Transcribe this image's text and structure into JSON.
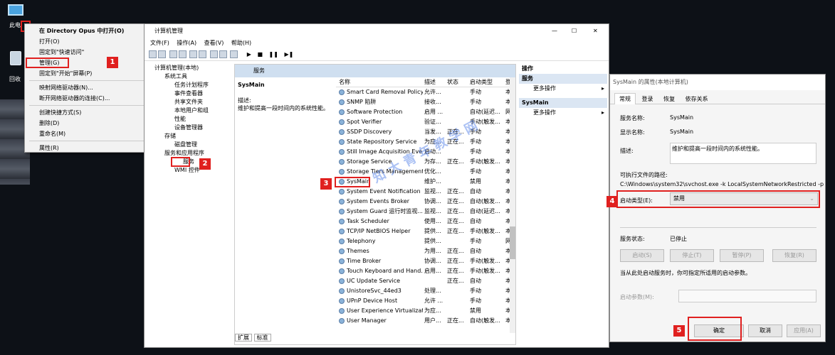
{
  "desktop": {
    "this_pc_label": "此电",
    "recycle_label": "回收"
  },
  "context_menu": {
    "items": [
      "在 Directory Opus 中打开(O)",
      "打开(O)",
      "固定到\"快速访问\"",
      "管理(G)",
      "固定到\"开始\"屏幕(P)",
      "映射网络驱动器(N)...",
      "断开网络驱动器的连接(C)...",
      "创建快捷方式(S)",
      "删除(D)",
      "重命名(M)",
      "属性(R)"
    ]
  },
  "badges": [
    "1",
    "2",
    "3",
    "4",
    "5"
  ],
  "mmc": {
    "title": "计算机管理",
    "menu": [
      "文件(F)",
      "操作(A)",
      "查看(V)",
      "帮助(H)"
    ],
    "window_controls": [
      "—",
      "☐",
      "✕"
    ],
    "tree": [
      "计算机管理(本地)",
      "系统工具",
      "任务计划程序",
      "事件查看器",
      "共享文件夹",
      "本地用户和组",
      "性能",
      "设备管理器",
      "存储",
      "磁盘管理",
      "服务和应用程序",
      "服务",
      "WMI 控件"
    ],
    "pane_header": "服务",
    "selected_service": "SysMain",
    "desc_label": "描述:",
    "desc_text": "维护和提高一段时间内的系统性能。",
    "columns": [
      "名称",
      "描述",
      "状态",
      "启动类型",
      "登"
    ],
    "rows": [
      [
        "Smart Card Removal Policy",
        "允许...",
        "",
        "手动",
        "本"
      ],
      [
        "SNMP 陷阱",
        "接收...",
        "",
        "手动",
        "本"
      ],
      [
        "Software Protection",
        "启用 ...",
        "",
        "自动(延迟...",
        "网"
      ],
      [
        "Spot Verifier",
        "验证...",
        "",
        "手动(触发...",
        "本"
      ],
      [
        "SSDP Discovery",
        "当发...",
        "正在...",
        "手动",
        "本"
      ],
      [
        "State Repository Service",
        "为应...",
        "正在...",
        "手动",
        "本"
      ],
      [
        "Still Image Acquisition Eve...",
        "启动...",
        "",
        "手动",
        "本"
      ],
      [
        "Storage Service",
        "为存...",
        "正在...",
        "手动(触发...",
        "本"
      ],
      [
        "Storage Tiers Management",
        "优化...",
        "",
        "手动",
        "本"
      ],
      [
        "SysMain",
        "维护...",
        "",
        "禁用",
        "本"
      ],
      [
        "System Event Notification ...",
        "监视...",
        "正在...",
        "自动",
        "本"
      ],
      [
        "System Events Broker",
        "协调...",
        "正在...",
        "自动(触发...",
        "本"
      ],
      [
        "System Guard 运行时监视...",
        "监视...",
        "正在...",
        "自动(延迟...",
        "本"
      ],
      [
        "Task Scheduler",
        "使用...",
        "正在...",
        "自动",
        "本"
      ],
      [
        "TCP/IP NetBIOS Helper",
        "提供...",
        "正在...",
        "手动(触发...",
        "本"
      ],
      [
        "Telephony",
        "提供...",
        "",
        "手动",
        "网"
      ],
      [
        "Themes",
        "为用...",
        "正在...",
        "自动",
        "本"
      ],
      [
        "Time Broker",
        "协调...",
        "正在...",
        "手动(触发...",
        "本"
      ],
      [
        "Touch Keyboard and Hand...",
        "启用...",
        "正在...",
        "手动(触发...",
        "本"
      ],
      [
        "UC Update Service",
        "",
        "正在...",
        "自动",
        "本"
      ],
      [
        "UnistoreSvc_44ed3",
        "处理...",
        "",
        "手动",
        "本"
      ],
      [
        "UPnP Device Host",
        "允许 ...",
        "",
        "手动",
        "本"
      ],
      [
        "User Experience Virtualizat...",
        "为应...",
        "",
        "禁用",
        "本"
      ],
      [
        "User Manager",
        "用户...",
        "正在...",
        "自动(触发...",
        "本"
      ]
    ],
    "bottom_tabs": [
      "扩展",
      "标准"
    ],
    "actions": {
      "title": "操作",
      "group1": "服务",
      "group1_item": "更多操作",
      "group2": "SysMain",
      "group2_item": "更多操作"
    }
  },
  "watermark": "知 大 青 年 教 学 网",
  "dialog": {
    "title": "SysMain 的属性(本地计算机)",
    "tabs": [
      "常规",
      "登录",
      "恢复",
      "依存关系"
    ],
    "service_name_label": "服务名称:",
    "service_name": "SysMain",
    "display_name_label": "显示名称:",
    "display_name": "SysMain",
    "desc_label": "描述:",
    "desc": "维护和提高一段时间内的系统性能。",
    "path_label": "可执行文件的路径:",
    "path": "C:\\Windows\\system32\\svchost.exe -k LocalSystemNetworkRestricted -p",
    "startup_label": "启动类型(E):",
    "startup_value": "禁用",
    "status_label": "服务状态:",
    "status_value": "已停止",
    "buttons": [
      "启动(S)",
      "停止(T)",
      "暂停(P)",
      "恢复(R)"
    ],
    "hint": "当从此处启动服务时，你可指定所适用的启动参数。",
    "param_label": "启动参数(M):",
    "ok": "确定",
    "cancel": "取消",
    "apply": "应用(A)"
  },
  "colors": {
    "highlight": "#e0201f",
    "accent": "#2b6cb0"
  }
}
